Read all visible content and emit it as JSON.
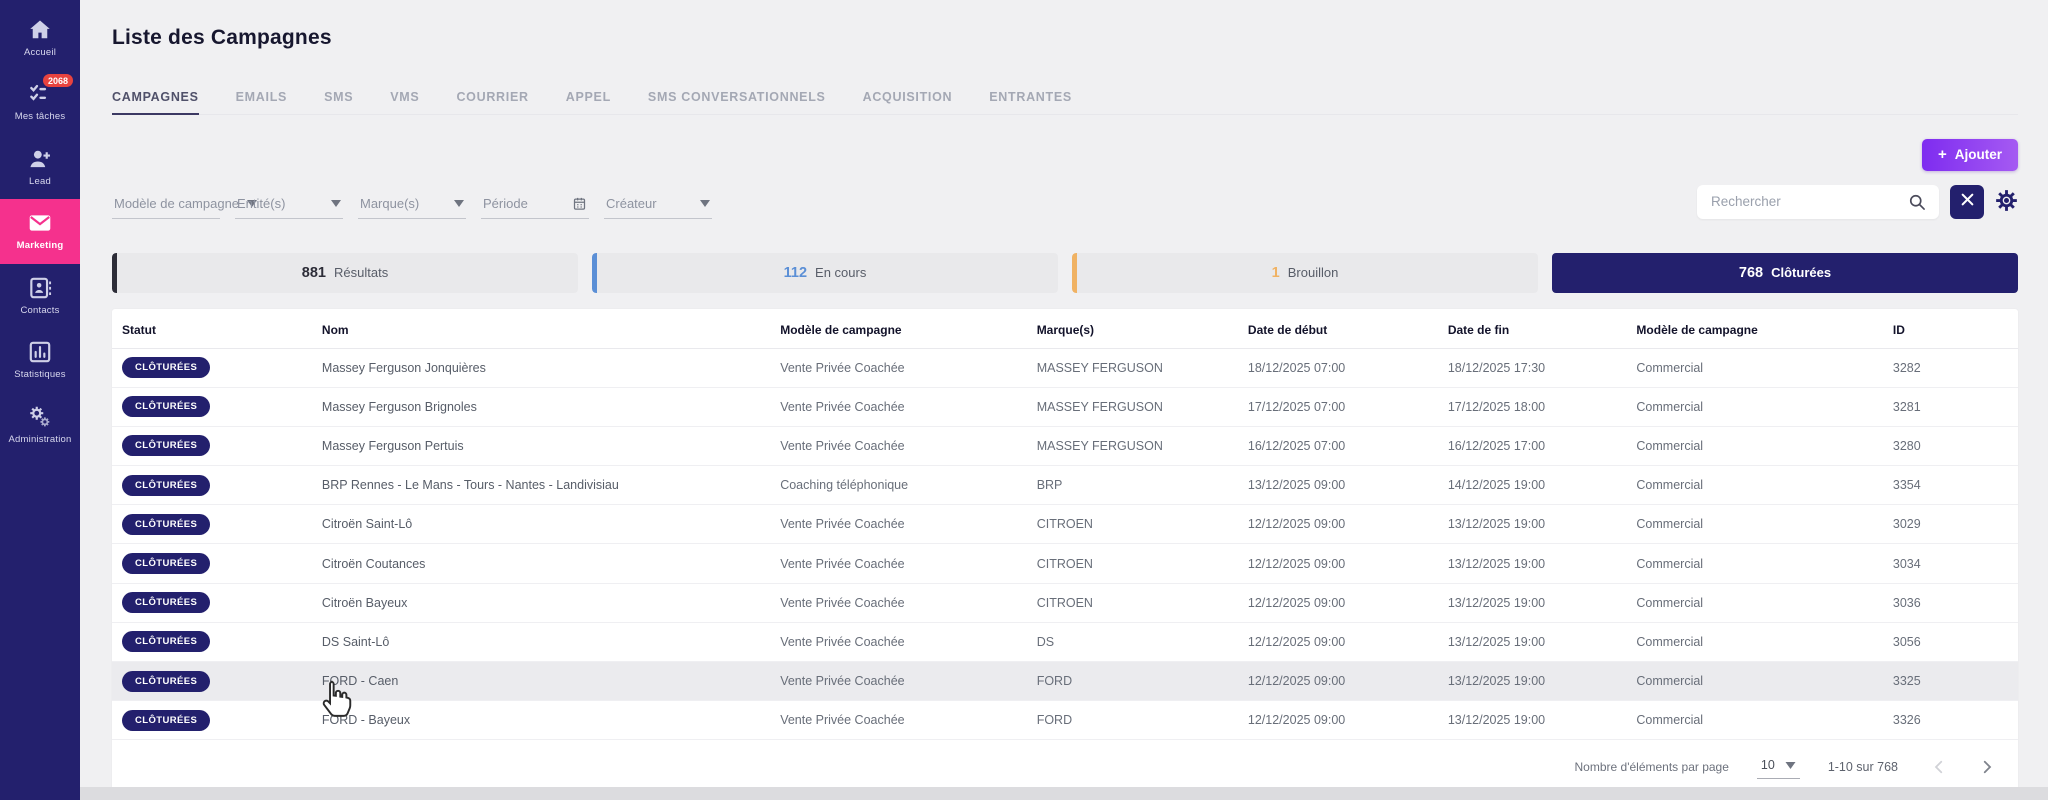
{
  "sidebar": {
    "items": [
      {
        "label": "Accueil",
        "icon": "home"
      },
      {
        "label": "Mes tâches",
        "icon": "tasks",
        "badge": "2068"
      },
      {
        "label": "Lead",
        "icon": "lead"
      },
      {
        "label": "Marketing",
        "icon": "envelope",
        "active": true
      },
      {
        "label": "Contacts",
        "icon": "contacts"
      },
      {
        "label": "Statistiques",
        "icon": "stats"
      },
      {
        "label": "Administration",
        "icon": "gears"
      }
    ]
  },
  "header": {
    "title": "Liste des Campagnes"
  },
  "tabs": [
    {
      "label": "CAMPAGNES",
      "active": true
    },
    {
      "label": "EMAILS"
    },
    {
      "label": "SMS"
    },
    {
      "label": "VMS"
    },
    {
      "label": "COURRIER"
    },
    {
      "label": "APPEL"
    },
    {
      "label": "SMS CONVERSATIONNELS"
    },
    {
      "label": "ACQUISITION"
    },
    {
      "label": "ENTRANTES"
    }
  ],
  "actions": {
    "add_plus": "+",
    "add_label": "Ajouter"
  },
  "filters": [
    {
      "label": "Modèle de campagne",
      "icon": "chevron-down"
    },
    {
      "label": "Entité(s)",
      "icon": "chevron-down"
    },
    {
      "label": "Marque(s)",
      "icon": "chevron-down"
    },
    {
      "label": "Période",
      "icon": "calendar"
    },
    {
      "label": "Créateur",
      "icon": "chevron-down"
    }
  ],
  "search": {
    "placeholder": "Rechercher"
  },
  "status_cards": [
    {
      "count": "881",
      "label": "Résultats",
      "accent": "#2d2d38"
    },
    {
      "count": "112",
      "label": "En cours",
      "accent": "#5b8fd6"
    },
    {
      "count": "1",
      "label": "Brouillon",
      "accent": "#f0b263"
    },
    {
      "count": "768",
      "label": "Clôturées",
      "accent": "#23206d",
      "selected": true
    }
  ],
  "table": {
    "columns": [
      "Statut",
      "Nom",
      "Modèle de campagne",
      "Marque(s)",
      "Date de début",
      "Date de fin",
      "Modèle de campagne",
      "ID"
    ],
    "rows": [
      {
        "status": "CLÔTURÉES",
        "name": "Massey Ferguson Jonquières",
        "model": "Vente Privée Coachée",
        "brands": "MASSEY FERGUSON",
        "start": "18/12/2025 07:00",
        "end": "18/12/2025 17:30",
        "model2": "Commercial",
        "id": "3282"
      },
      {
        "status": "CLÔTURÉES",
        "name": "Massey Ferguson Brignoles",
        "model": "Vente Privée Coachée",
        "brands": "MASSEY FERGUSON",
        "start": "17/12/2025 07:00",
        "end": "17/12/2025 18:00",
        "model2": "Commercial",
        "id": "3281"
      },
      {
        "status": "CLÔTURÉES",
        "name": "Massey Ferguson Pertuis",
        "model": "Vente Privée Coachée",
        "brands": "MASSEY FERGUSON",
        "start": "16/12/2025 07:00",
        "end": "16/12/2025 17:00",
        "model2": "Commercial",
        "id": "3280"
      },
      {
        "status": "CLÔTURÉES",
        "name": "BRP Rennes - Le Mans - Tours - Nantes - Landivisiau",
        "model": "Coaching téléphonique",
        "brands": "BRP",
        "start": "13/12/2025 09:00",
        "end": "14/12/2025 19:00",
        "model2": "Commercial",
        "id": "3354"
      },
      {
        "status": "CLÔTURÉES",
        "name": "Citroën Saint-Lô",
        "model": "Vente Privée Coachée",
        "brands": "CITROEN",
        "start": "12/12/2025 09:00",
        "end": "13/12/2025 19:00",
        "model2": "Commercial",
        "id": "3029"
      },
      {
        "status": "CLÔTURÉES",
        "name": "Citroën Coutances",
        "model": "Vente Privée Coachée",
        "brands": "CITROEN",
        "start": "12/12/2025 09:00",
        "end": "13/12/2025 19:00",
        "model2": "Commercial",
        "id": "3034"
      },
      {
        "status": "CLÔTURÉES",
        "name": "Citroën Bayeux",
        "model": "Vente Privée Coachée",
        "brands": "CITROEN",
        "start": "12/12/2025 09:00",
        "end": "13/12/2025 19:00",
        "model2": "Commercial",
        "id": "3036"
      },
      {
        "status": "CLÔTURÉES",
        "name": "DS Saint-Lô",
        "model": "Vente Privée Coachée",
        "brands": "DS",
        "start": "12/12/2025 09:00",
        "end": "13/12/2025 19:00",
        "model2": "Commercial",
        "id": "3056"
      },
      {
        "status": "CLÔTURÉES",
        "name": "FORD - Caen",
        "model": "Vente Privée Coachée",
        "brands": "FORD",
        "start": "12/12/2025 09:00",
        "end": "13/12/2025 19:00",
        "model2": "Commercial",
        "id": "3325",
        "hover": true
      },
      {
        "status": "CLÔTURÉES",
        "name": "FORD - Bayeux",
        "model": "Vente Privée Coachée",
        "brands": "FORD",
        "start": "12/12/2025 09:00",
        "end": "13/12/2025 19:00",
        "model2": "Commercial",
        "id": "3326"
      }
    ]
  },
  "pagination": {
    "per_page_label": "Nombre d'éléments par page",
    "per_page": "10",
    "range": "1-10 sur 768"
  }
}
